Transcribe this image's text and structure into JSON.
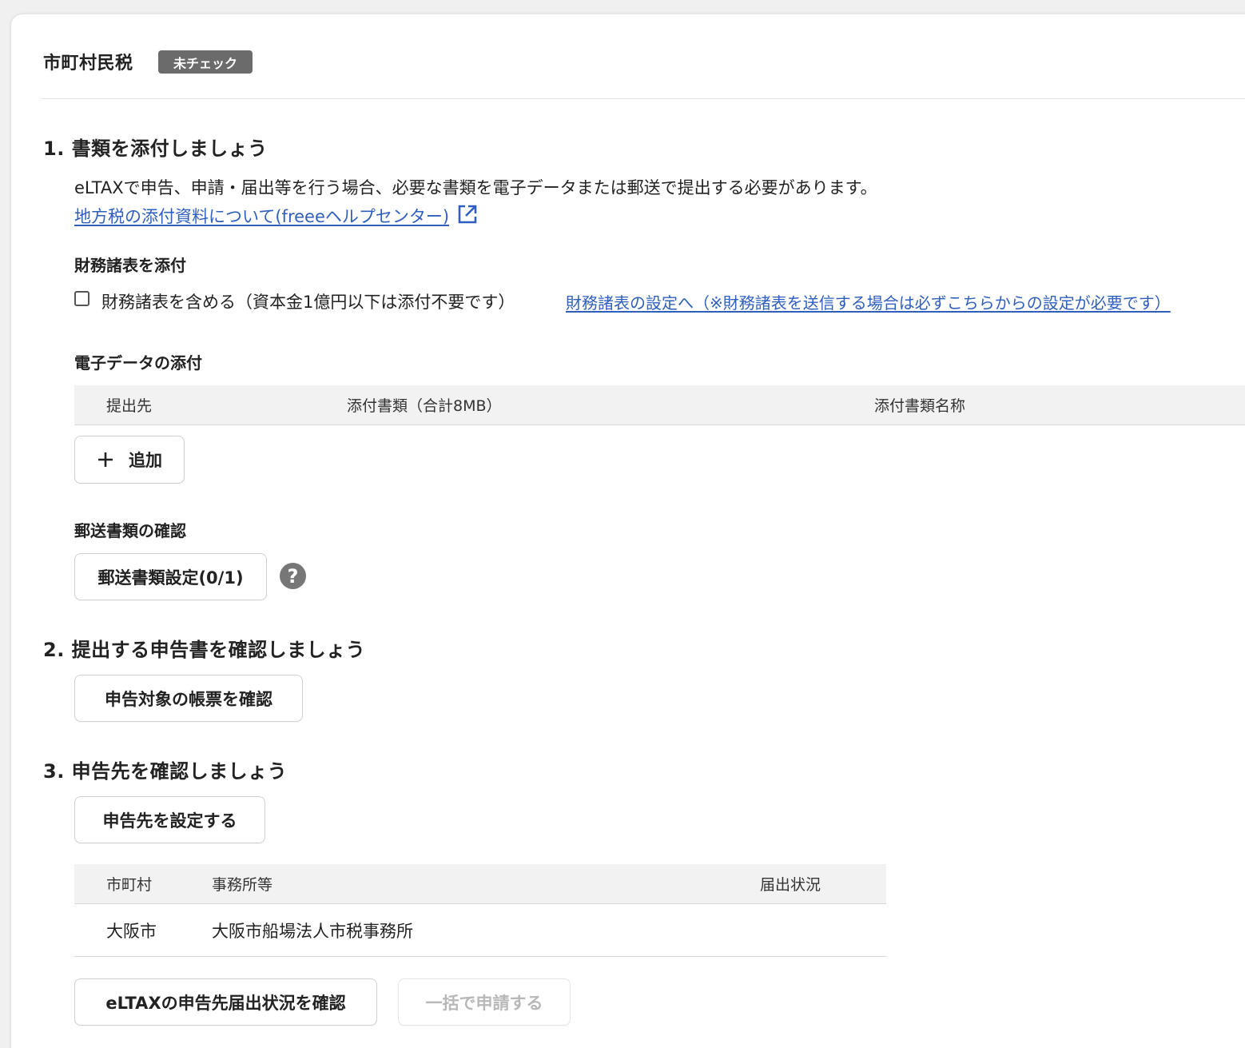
{
  "header": {
    "title": "市町村民税",
    "status_badge": "未チェック"
  },
  "step1": {
    "heading": "1. 書類を添付しましょう",
    "description": "eLTAXで申告、申請・届出等を行う場合、必要な書類を電子データまたは郵送で提出する必要があります。",
    "help_link": "地方税の添付資料について(freeeヘルプセンター)",
    "financial": {
      "heading": "財務諸表を添付",
      "checkbox_label": "財務諸表を含める（資本金1億円以下は添付不要です）",
      "checked": false,
      "settings_link": "財務諸表の設定へ（※財務諸表を送信する場合は必ずこちらからの設定が必要です）"
    },
    "electronic": {
      "heading": "電子データの添付",
      "columns": [
        "提出先",
        "添付書類（合計8MB）",
        "添付書類名称"
      ],
      "add_button": "追加"
    },
    "mail": {
      "heading": "郵送書類の確認",
      "button": "郵送書類設定(0/1)",
      "help_icon": "question-mark-circle-icon"
    }
  },
  "step2": {
    "heading": "2. 提出する申告書を確認しましょう",
    "button": "申告対象の帳票を確認"
  },
  "step3": {
    "heading": "3. 申告先を確認しましょう",
    "set_button": "申告先を設定する",
    "columns": [
      "市町村",
      "事務所等",
      "届出状況"
    ],
    "rows": [
      {
        "city": "大阪市",
        "office": "大阪市船場法人市税事務所",
        "status": ""
      }
    ],
    "check_button": "eLTAXの申告先届出状況を確認",
    "submit_button": "一括で申請する"
  },
  "colors": {
    "link": "#2f5fbd",
    "badge_bg": "#6b6b6b",
    "table_header_bg": "#f3f2f2",
    "disabled_text": "#b8b8b8"
  }
}
